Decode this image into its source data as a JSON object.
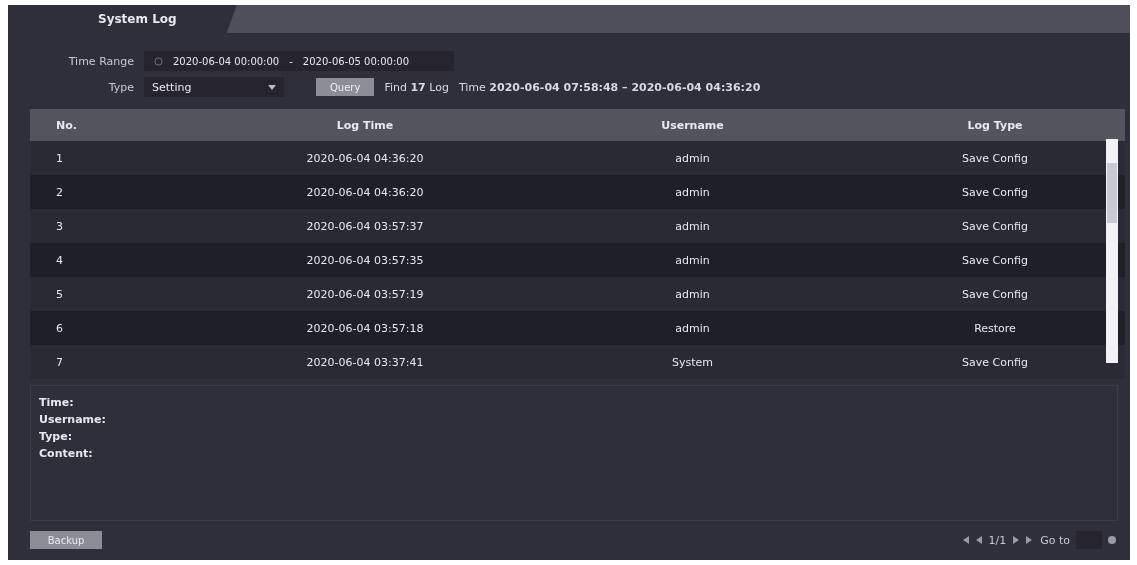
{
  "tabs": [
    {
      "label": "System Log",
      "selected": true
    }
  ],
  "filters": {
    "time_range_label": "Time Range",
    "start": "2020-06-04 00:00:00",
    "separator": "-",
    "end": "2020-06-05 00:00:00",
    "type_label": "Type",
    "type_value": "Setting",
    "query_button": "Query"
  },
  "result": {
    "count": "Find **17** Log",
    "time": "Time **2020-06-04 07:58:48 – 2020-06-04 04:36:20**"
  },
  "table": {
    "columns": [
      "No.",
      "Log Time",
      "Username",
      "Log Type"
    ],
    "rows": [
      [
        "1",
        "2020-06-04 04:36:20",
        "admin",
        "Save Config"
      ],
      [
        "2",
        "2020-06-04 04:36:20",
        "admin",
        "Save Config"
      ],
      [
        "3",
        "2020-06-04 03:57:37",
        "admin",
        "Save Config"
      ],
      [
        "4",
        "2020-06-04 03:57:35",
        "admin",
        "Save Config"
      ],
      [
        "5",
        "2020-06-04 03:57:19",
        "admin",
        "Save Config"
      ],
      [
        "6",
        "2020-06-04 03:57:18",
        "admin",
        "Restore"
      ],
      [
        "7",
        "2020-06-04 03:37:41",
        "System",
        "Save Config"
      ]
    ]
  },
  "details": [
    "Time:",
    "Username:",
    "Type:",
    "Content:"
  ],
  "backup_button": "Backup",
  "pagination": {
    "page": "1/1",
    "goto_label": "Go to"
  }
}
